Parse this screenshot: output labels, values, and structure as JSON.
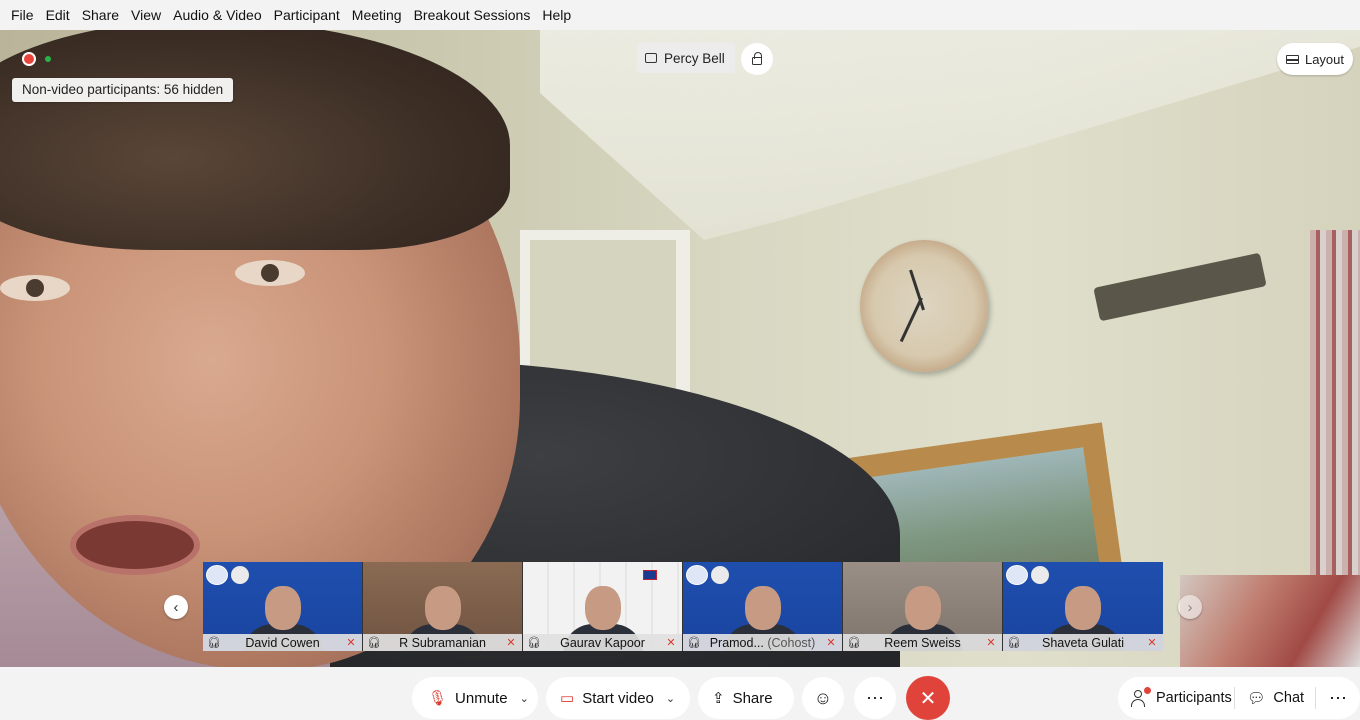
{
  "menu": [
    "File",
    "Edit",
    "Share",
    "View",
    "Audio & Video",
    "Participant",
    "Meeting",
    "Breakout Sessions",
    "Help"
  ],
  "overlay": {
    "nonvideo_text": "Non-video participants: 56 hidden",
    "active_speaker": "Percy Bell",
    "layout_label": "Layout"
  },
  "thumbnails": [
    {
      "name": "David Cowen",
      "role": "",
      "bg": "blue"
    },
    {
      "name": "R Subramanian",
      "role": "",
      "bg": "office"
    },
    {
      "name": "Gaurav Kapoor",
      "role": "",
      "bg": "white"
    },
    {
      "name": "Pramod...",
      "role": "(Cohost)",
      "bg": "blue"
    },
    {
      "name": "Reem Sweiss",
      "role": "",
      "bg": "room"
    },
    {
      "name": "Shaveta Gulati",
      "role": "",
      "bg": "blue"
    }
  ],
  "toolbar": {
    "unmute_label": "Unmute",
    "start_video_label": "Start video",
    "share_label": "Share",
    "participants_label": "Participants",
    "chat_label": "Chat"
  },
  "colors": {
    "end_red": "#e0433a",
    "muted_red": "#d93a2f",
    "thumb_blue": "#1f4fae"
  }
}
